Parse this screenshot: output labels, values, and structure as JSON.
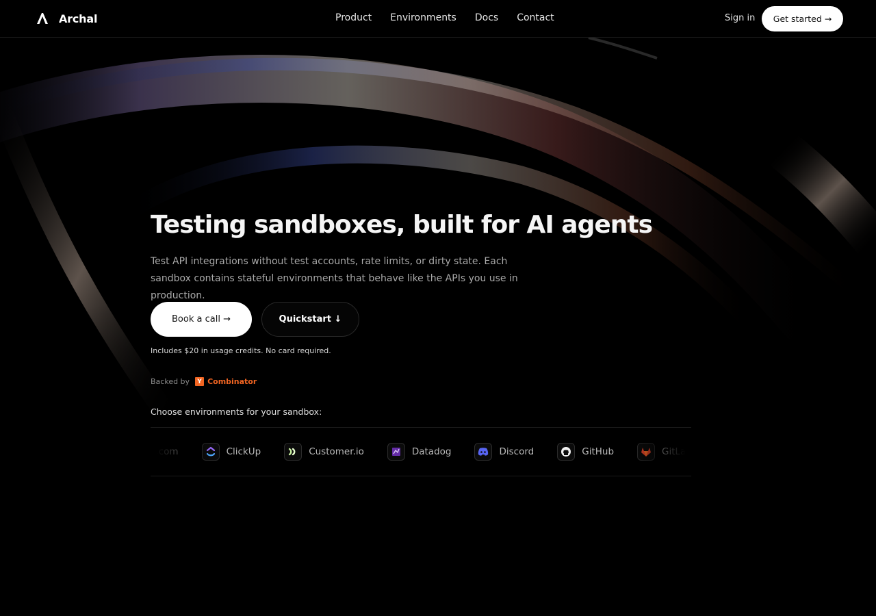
{
  "header": {
    "brand_name": "Archal",
    "nav": [
      {
        "label": "Product"
      },
      {
        "label": "Environments"
      },
      {
        "label": "Docs"
      },
      {
        "label": "Contact"
      }
    ],
    "sign_in": "Sign in",
    "get_started": "Get started →"
  },
  "hero": {
    "title": "Testing sandboxes, built for AI agents",
    "subtitle": "Test API integrations without test accounts, rate limits, or dirty state. Each sandbox contains stateful environments that behave like the APIs you use in production.",
    "primary_cta": "Book a call →",
    "secondary_cta": "Quickstart ↓",
    "credits_note": "Includes $20 in usage credits. No card required.",
    "backed_label": "Backed by",
    "backer_logo": "Y",
    "backer_name": "Combinator"
  },
  "environments": {
    "heading": "Choose environments for your sandbox:",
    "items": [
      {
        "label": "Cal.com",
        "icon": "calcom-icon"
      },
      {
        "label": "ClickUp",
        "icon": "clickup-icon"
      },
      {
        "label": "Customer.io",
        "icon": "customerio-icon"
      },
      {
        "label": "Datadog",
        "icon": "datadog-icon"
      },
      {
        "label": "Discord",
        "icon": "discord-icon"
      },
      {
        "label": "GitHub",
        "icon": "github-icon"
      },
      {
        "label": "GitLab",
        "icon": "gitlab-icon"
      }
    ]
  },
  "colors": {
    "background": "#000000",
    "accent_yc": "#f26522",
    "button_light": "#ffffff"
  }
}
